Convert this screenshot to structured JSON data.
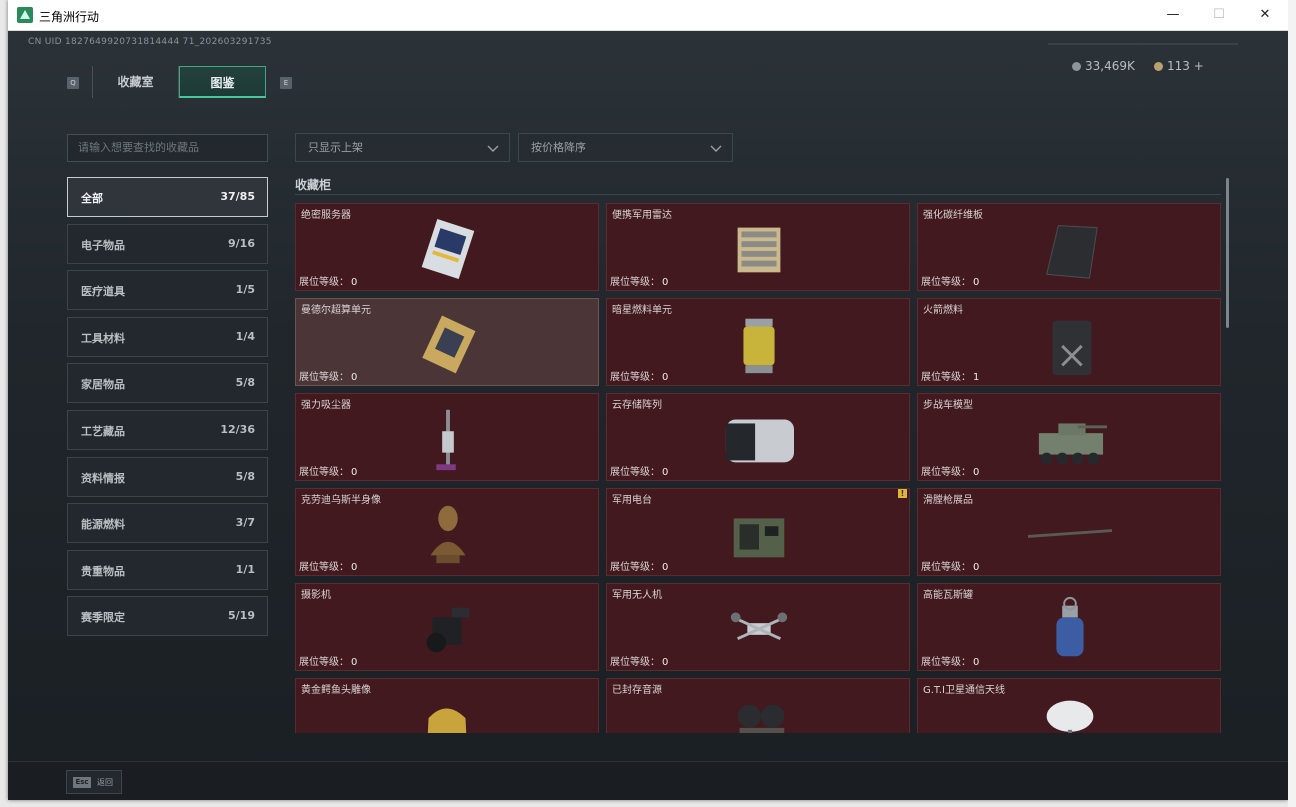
{
  "window": {
    "title": "三角洲行动",
    "minimize_glyph": "—",
    "maximize_glyph": "☐",
    "close_glyph": "✕"
  },
  "header": {
    "uid": "CN UID 1827649920731814444 71_202603291735",
    "tab_key_left": "Q",
    "tab_key_right": "E",
    "tabs": [
      {
        "label": "收藏室"
      },
      {
        "label": "图鉴"
      }
    ],
    "currency_a": "33,469K",
    "currency_b": "113 +"
  },
  "sidebar": {
    "search_placeholder": "请输入想要查找的收藏品",
    "categories": [
      {
        "label": "全部",
        "count": "37/85"
      },
      {
        "label": "电子物品",
        "count": "9/16"
      },
      {
        "label": "医疗道具",
        "count": "1/5"
      },
      {
        "label": "工具材料",
        "count": "1/4"
      },
      {
        "label": "家居物品",
        "count": "5/8"
      },
      {
        "label": "工艺藏品",
        "count": "12/36"
      },
      {
        "label": "资料情报",
        "count": "5/8"
      },
      {
        "label": "能源燃料",
        "count": "3/7"
      },
      {
        "label": "贵重物品",
        "count": "1/1"
      },
      {
        "label": "赛季限定",
        "count": "5/19"
      }
    ]
  },
  "filters": {
    "shelf_filter": "只显示上架",
    "sort": "按价格降序"
  },
  "main": {
    "section_title": "收藏柜",
    "level_label": "展位等级：",
    "items": [
      {
        "name": "绝密服务器",
        "level": "0",
        "icon": "server-board-icon"
      },
      {
        "name": "便携军用雷达",
        "level": "0",
        "icon": "radar-icon"
      },
      {
        "name": "强化碳纤维板",
        "level": "0",
        "icon": "carbon-plate-icon"
      },
      {
        "name": "曼德尔超算单元",
        "level": "0",
        "icon": "supercompute-unit-icon"
      },
      {
        "name": "暗星燃料单元",
        "level": "0",
        "icon": "fuel-cell-icon"
      },
      {
        "name": "火箭燃料",
        "level": "1",
        "icon": "jerrycan-icon"
      },
      {
        "name": "强力吸尘器",
        "level": "0",
        "icon": "vacuum-icon"
      },
      {
        "name": "云存储阵列",
        "level": "0",
        "icon": "storage-array-icon"
      },
      {
        "name": "步战车模型",
        "level": "0",
        "icon": "ifv-model-icon"
      },
      {
        "name": "克劳迪乌斯半身像",
        "level": "0",
        "icon": "bust-icon"
      },
      {
        "name": "军用电台",
        "level": "0",
        "icon": "radio-icon"
      },
      {
        "name": "滑膛枪展品",
        "level": "0",
        "icon": "musket-icon"
      },
      {
        "name": "摄影机",
        "level": "0",
        "icon": "camera-icon"
      },
      {
        "name": "军用无人机",
        "level": "0",
        "icon": "drone-icon"
      },
      {
        "name": "高能瓦斯罐",
        "level": "0",
        "icon": "gas-tank-icon"
      },
      {
        "name": "黄金鳄鱼头雕像",
        "level": "",
        "icon": "gold-croc-icon"
      },
      {
        "name": "已封存音源",
        "level": "",
        "icon": "reel-recorder-icon"
      },
      {
        "name": "G.T.I卫星通信天线",
        "level": "",
        "icon": "satellite-dish-icon"
      }
    ]
  },
  "footer": {
    "esc_key": "Esc",
    "esc_label": "返回"
  },
  "colors": {
    "card_bg": "#42191f",
    "accent": "#46c89a"
  }
}
